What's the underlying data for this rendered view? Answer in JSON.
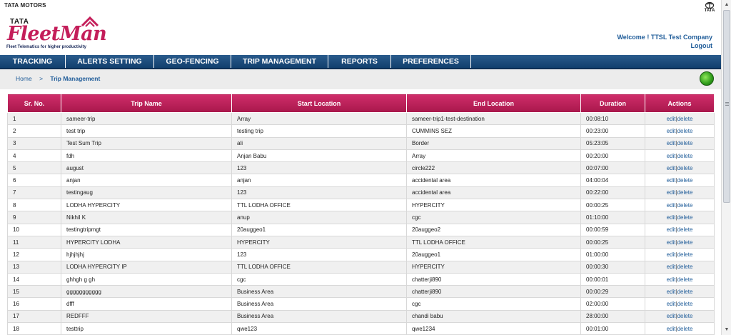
{
  "brand": {
    "company": "TATA MOTORS",
    "corner_logo_text": "TATA",
    "logo_tata": "TATA",
    "logo_name": "FleetMan",
    "tagline": "Fleet Telematics for higher productivity",
    "accent_color": "#c41e5a",
    "nav_color": "#1e4f80"
  },
  "user": {
    "welcome": "Welcome ! TTSL Test Company",
    "logout": "Logout"
  },
  "nav": {
    "items": [
      {
        "label": "TRACKING"
      },
      {
        "label": "ALERTS SETTING"
      },
      {
        "label": "GEO-FENCING"
      },
      {
        "label": "TRIP MANAGEMENT"
      },
      {
        "label": "REPORTS"
      },
      {
        "label": "PREFERENCES"
      }
    ]
  },
  "breadcrumb": {
    "home": "Home",
    "separator": ">",
    "current": "Trip Management"
  },
  "table": {
    "columns": [
      "Sr. No.",
      "Trip Name",
      "Start Location",
      "End Location",
      "Duration",
      "Actions"
    ],
    "edit_label": "edit",
    "action_sep": "|",
    "delete_label": "delete",
    "rows": [
      {
        "sr": "1",
        "name": "sameer-trip",
        "start": "Array",
        "end": "sameer-trip1-test-destination",
        "duration": "00:08:10"
      },
      {
        "sr": "2",
        "name": "test trip",
        "start": "testing trip",
        "end": "CUMMINS SEZ",
        "duration": "00:23:00"
      },
      {
        "sr": "3",
        "name": "Test Sum Trip",
        "start": "ali",
        "end": "Border",
        "duration": "05:23:05"
      },
      {
        "sr": "4",
        "name": "fdh",
        "start": "Anjan Babu",
        "end": "Array",
        "duration": "00:20:00"
      },
      {
        "sr": "5",
        "name": "august",
        "start": "123",
        "end": "circle222",
        "duration": "00:07:00"
      },
      {
        "sr": "6",
        "name": "anjan",
        "start": "anjan",
        "end": "accidental area",
        "duration": "04:00:04"
      },
      {
        "sr": "7",
        "name": "testingaug",
        "start": "123",
        "end": "accidental area",
        "duration": "00:22:00"
      },
      {
        "sr": "8",
        "name": "LODHA HYPERCITY",
        "start": "TTL LODHA OFFICE",
        "end": "HYPERCITY",
        "duration": "00:00:25"
      },
      {
        "sr": "9",
        "name": "Nikhil K",
        "start": "anup",
        "end": "cgc",
        "duration": "01:10:00"
      },
      {
        "sr": "10",
        "name": "testingtripmgt",
        "start": "20auggeo1",
        "end": "20auggeo2",
        "duration": "00:00:59"
      },
      {
        "sr": "11",
        "name": "HYPERCITY LODHA",
        "start": "HYPERCITY",
        "end": "TTL LODHA OFFICE",
        "duration": "00:00:25"
      },
      {
        "sr": "12",
        "name": "hjhjhjhj",
        "start": "123",
        "end": "20auggeo1",
        "duration": "01:00:00"
      },
      {
        "sr": "13",
        "name": "LODHA HYPERCITY IP",
        "start": "TTL LODHA OFFICE",
        "end": "HYPERCITY",
        "duration": "00:00:30"
      },
      {
        "sr": "14",
        "name": "ghhgh g gh",
        "start": "cgc",
        "end": "chatterji890",
        "duration": "00:00:01"
      },
      {
        "sr": "15",
        "name": "ggggggggggg",
        "start": "Business Area",
        "end": "chatterji890",
        "duration": "00:00:29"
      },
      {
        "sr": "16",
        "name": "dfff",
        "start": "Business Area",
        "end": "cgc",
        "duration": "02:00:00"
      },
      {
        "sr": "17",
        "name": "REDFFF",
        "start": "Business Area",
        "end": "chandi babu",
        "duration": "28:00:00"
      },
      {
        "sr": "18",
        "name": "testtrip",
        "start": "qwe123",
        "end": "qwe1234",
        "duration": "00:01:00"
      }
    ]
  }
}
